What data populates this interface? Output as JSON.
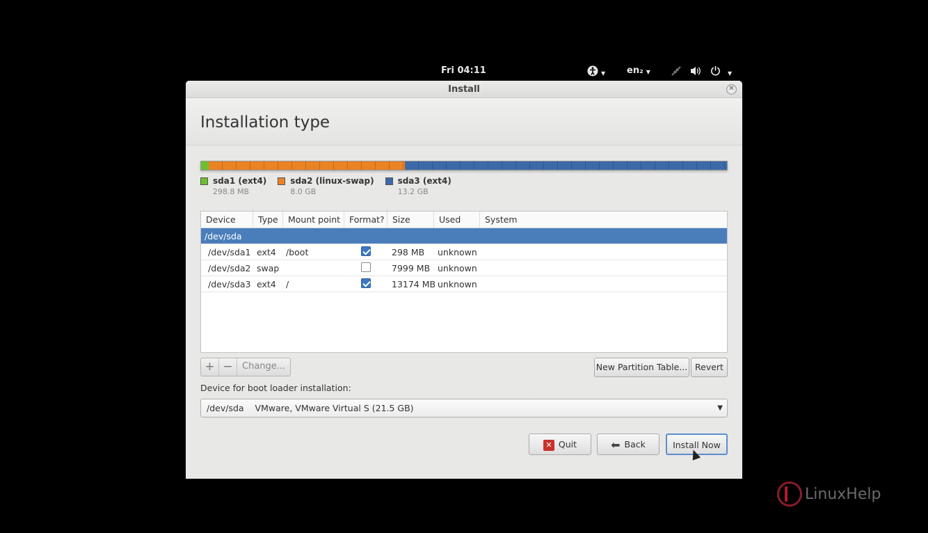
{
  "panel": {
    "clock": "Fri 04:11",
    "language": "en₂",
    "icons": [
      "accessibility-icon",
      "network-icon",
      "volume-icon",
      "power-icon"
    ]
  },
  "window": {
    "title": "Install",
    "heading": "Installation type"
  },
  "partition_bar": {
    "colors": {
      "sda1": "#6dbf2f",
      "sda2": "#e98323",
      "sda3": "#3c6aa8"
    },
    "shares": {
      "sda1": 0.014,
      "sda2": 0.373,
      "sda3": 0.613
    }
  },
  "legend": [
    {
      "name": "sda1 (ext4)",
      "size": "298.8 MB",
      "color": "#6dbf2f"
    },
    {
      "name": "sda2 (linux-swap)",
      "size": "8.0 GB",
      "color": "#e98323"
    },
    {
      "name": "sda3 (ext4)",
      "size": "13.2 GB",
      "color": "#3c6aa8"
    }
  ],
  "table": {
    "columns": [
      "Device",
      "Type",
      "Mount point",
      "Format?",
      "Size",
      "Used",
      "System"
    ],
    "disk": "/dev/sda",
    "rows": [
      {
        "device": "/dev/sda1",
        "type": "ext4",
        "mount": "/boot",
        "format": true,
        "size": "298 MB",
        "used": "unknown",
        "system": ""
      },
      {
        "device": "/dev/sda2",
        "type": "swap",
        "mount": "",
        "format": false,
        "size": "7999 MB",
        "used": "unknown",
        "system": ""
      },
      {
        "device": "/dev/sda3",
        "type": "ext4",
        "mount": "/",
        "format": true,
        "size": "13174 MB",
        "used": "unknown",
        "system": ""
      }
    ]
  },
  "toolbar": {
    "add": "+",
    "remove": "−",
    "change": "Change...",
    "new_partition_table": "New Partition Table...",
    "revert": "Revert"
  },
  "bootloader": {
    "label": "Device for boot loader installation:",
    "device": "/dev/sda",
    "description": "VMware, VMware Virtual S (21.5 GB)"
  },
  "buttons": {
    "quit": "Quit",
    "back": "Back",
    "install_now": "Install Now"
  },
  "watermark": "LinuxHelp"
}
